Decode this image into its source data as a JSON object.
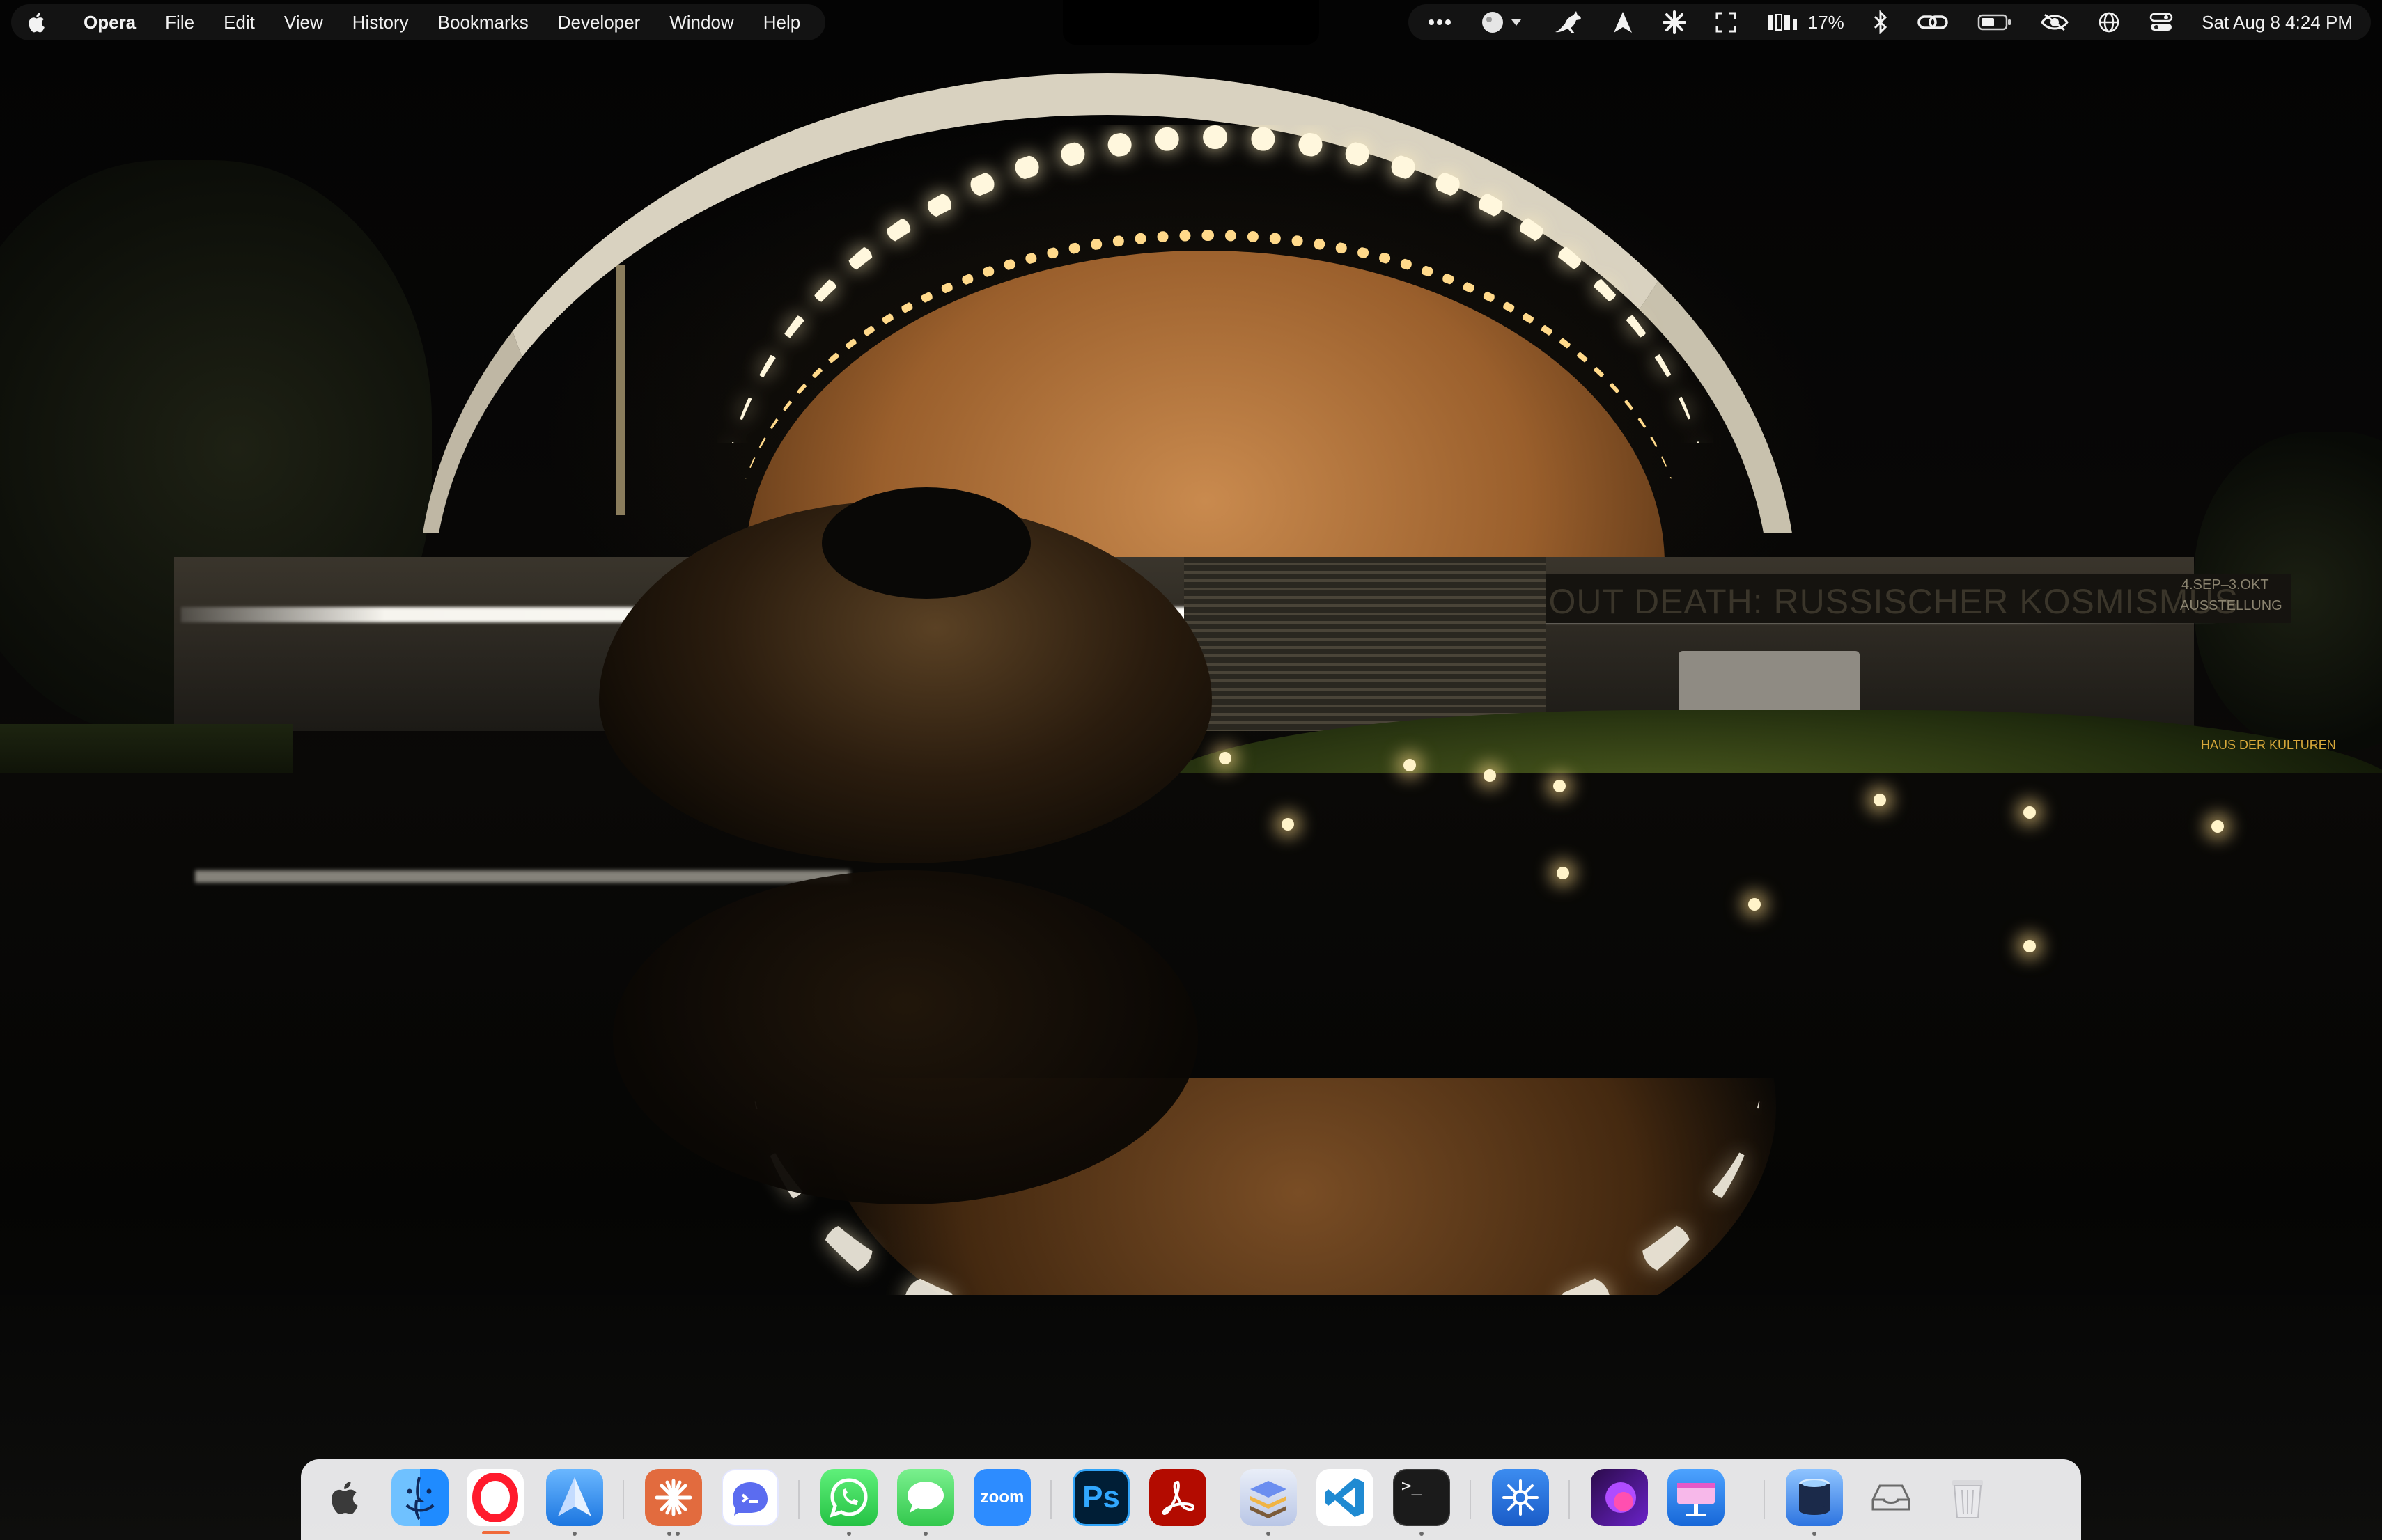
{
  "menubar": {
    "apple_icon": "apple-icon",
    "app_name": "Opera",
    "menus": [
      "File",
      "Edit",
      "View",
      "History",
      "Bookmarks",
      "Developer",
      "Window",
      "Help"
    ],
    "status": {
      "battery_percent_text": "17%",
      "datetime": "Sat Aug 8  4:24 PM",
      "icons": [
        "more-icon",
        "avatar-dropdown-icon",
        "kangaroo-icon",
        "arrow-up-icon",
        "sparkle-icon",
        "expand-icon",
        "battery-stats-icon",
        "bluetooth-icon",
        "link-icon",
        "battery-icon",
        "eye-slash-icon",
        "globe-icon",
        "control-center-icon"
      ]
    }
  },
  "wallpaper": {
    "banner_text": "RT WITHOUT DEATH: RUSSISCHER KOSMISMUS",
    "banner_dates": "4.SEP–3.OKT",
    "banner_sub": "AUSSTELLUNG",
    "sign_text": "HAUS DER KULTUREN"
  },
  "dock": {
    "zoom_label": "zoom",
    "ps_label": "Ps",
    "terminal_label": ">_",
    "items": [
      {
        "name": "launchpad-apple",
        "running": false
      },
      {
        "name": "finder",
        "running": false
      },
      {
        "name": "opera",
        "running": true
      },
      {
        "name": "testflight",
        "running": true
      },
      {
        "name": "claude",
        "running": true
      },
      {
        "name": "copilot",
        "running": false
      },
      {
        "name": "whatsapp",
        "running": true
      },
      {
        "name": "messages",
        "running": true
      },
      {
        "name": "zoom",
        "running": false
      },
      {
        "name": "photoshop",
        "running": false
      },
      {
        "name": "acrobat",
        "running": false
      },
      {
        "name": "stacks",
        "running": true
      },
      {
        "name": "vscode",
        "running": false
      },
      {
        "name": "terminal",
        "running": true
      },
      {
        "name": "perplexity",
        "running": false
      },
      {
        "name": "arc",
        "running": false
      },
      {
        "name": "keynote",
        "running": false
      },
      {
        "name": "preview",
        "running": true
      },
      {
        "name": "downloads",
        "running": false
      },
      {
        "name": "trash",
        "running": false
      }
    ]
  }
}
